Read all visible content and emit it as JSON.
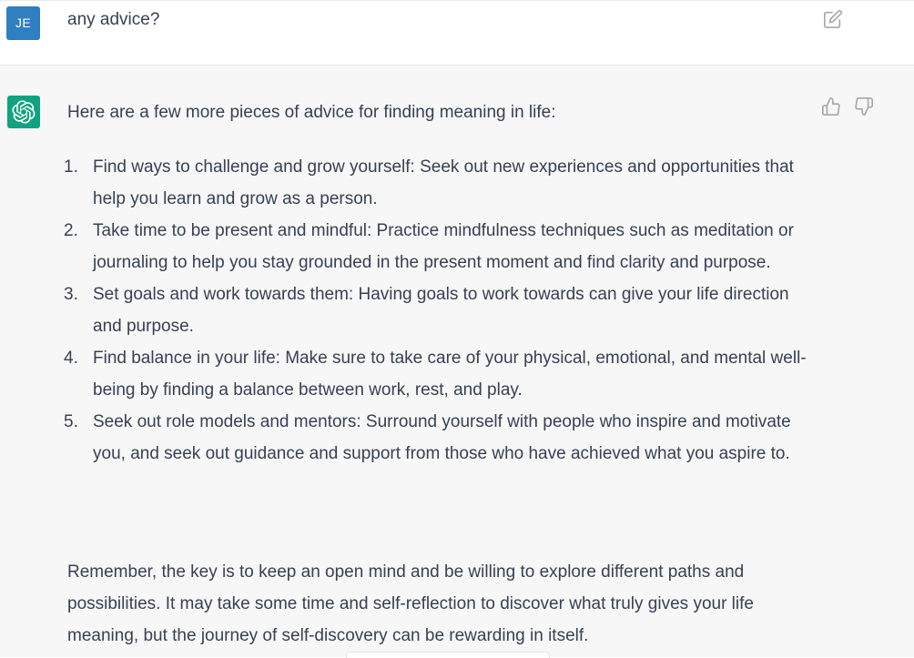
{
  "user_message": {
    "avatar_initials": "JE",
    "text": "any advice?",
    "edit_icon": "edit-icon"
  },
  "assistant_message": {
    "avatar_icon": "openai-logo-icon",
    "intro": "Here are a few more pieces of advice for finding meaning in life:",
    "items": [
      {
        "num": "1.",
        "text": "Find ways to challenge and grow yourself: Seek out new experiences and opportunities that help you learn and grow as a person."
      },
      {
        "num": "2.",
        "text": "Take time to be present and mindful: Practice mindfulness techniques such as meditation or journaling to help you stay grounded in the present moment and find clarity and purpose."
      },
      {
        "num": "3.",
        "text": "Set goals and work towards them: Having goals to work towards can give your life direction and purpose."
      },
      {
        "num": "4.",
        "text": "Find balance in your life: Make sure to take care of your physical, emotional, and mental well-being by finding a balance between work, rest, and play."
      },
      {
        "num": "5.",
        "text": "Seek out role models and mentors: Surround yourself with people who inspire and motivate you, and seek out guidance and support from those who have achieved what you aspire to."
      }
    ],
    "outro": "Remember, the key is to keep an open mind and be willing to explore different paths and possibilities. It may take some time and self-reflection to discover what truly gives your life meaning, but the journey of self-discovery can be rewarding in itself.",
    "feedback": {
      "up_icon": "thumbs-up-icon",
      "down_icon": "thumbs-down-icon"
    }
  },
  "colors": {
    "user_avatar": "#2f7fc1",
    "bot_avatar": "#10a37f",
    "assistant_bg": "#f7f7f8",
    "text": "#374151"
  }
}
